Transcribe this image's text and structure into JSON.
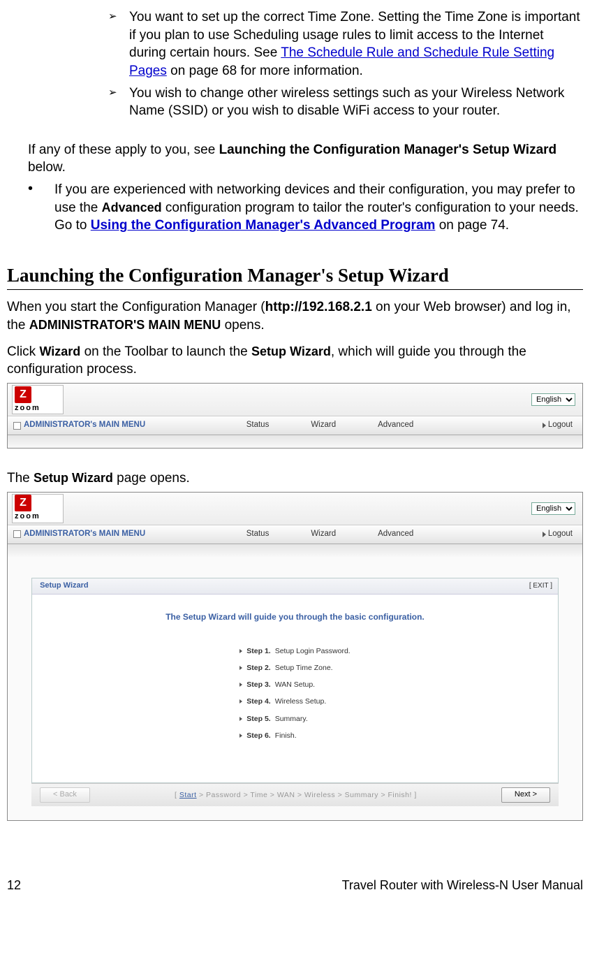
{
  "intro": {
    "bullet1_pre": "You want to set up the correct Time Zone. Setting the Time Zone is important if you plan to use Scheduling usage rules to limit access to the Internet during certain hours. See ",
    "bullet1_link": "The Schedule Rule and Schedule Rule Setting Pages",
    "bullet1_post": " on page 68 for more information.",
    "bullet2": "You wish to change other wireless settings such as your Wireless Network Name (SSID) or you wish to disable WiFi access to your router.",
    "apply_pre": "If any of these apply to you, see ",
    "apply_bold": "Launching the Configuration Manager's Setup Wizard",
    "apply_post": " below.",
    "dot_pre": "If you are experienced with networking devices and their configuration, you may prefer to use the ",
    "dot_adv": "Advanced",
    "dot_mid": " configuration program to tailor the router's configuration to your needs. Go to ",
    "dot_link": "Using the Configuration Manager's Advanced Program",
    "dot_post": " on page 74."
  },
  "heading": "Launching the Configuration Manager's Setup Wizard",
  "p1_pre": "When you start the Configuration Manager (",
  "p1_bold": "http://192.168.2.1",
  "p1_mid": " on your Web browser) and log in, the ",
  "p1_menu": "ADMINISTRATOR'S MAIN MENU",
  "p1_post": " opens.",
  "p2_pre": "Click ",
  "p2_w1": "Wizard",
  "p2_mid": " on the Toolbar to launch the ",
  "p2_w2": "Setup Wizard",
  "p2_post": ", which will guide you through the configuration process.",
  "p3_pre": "The ",
  "p3_sw": "Setup Wizard",
  "p3_post": " page opens.",
  "ui": {
    "logo_z": "Z",
    "logo_txt": "zoom",
    "lang": "English",
    "admin_menu": "ADMINISTRATOR's MAIN MENU",
    "status": "Status",
    "wizard": "Wizard",
    "advanced": "Advanced",
    "logout": "Logout",
    "panel_title": "Setup Wizard",
    "exit": "[ EXIT ]",
    "headline": "The Setup Wizard will guide you through the basic configuration.",
    "steps": [
      {
        "b": "Step 1.",
        "t": "Setup Login Password."
      },
      {
        "b": "Step 2.",
        "t": "Setup Time Zone."
      },
      {
        "b": "Step 3.",
        "t": "WAN Setup."
      },
      {
        "b": "Step 4.",
        "t": "Wireless Setup."
      },
      {
        "b": "Step 5.",
        "t": "Summary."
      },
      {
        "b": "Step 6.",
        "t": "Finish."
      }
    ],
    "back": "< Back",
    "next": "Next >",
    "bc_open": "[ ",
    "bc_start": "Start",
    "bc_rest": " > Password > Time > WAN > Wireless > Summary > Finish! ]"
  },
  "footer": {
    "page": "12",
    "title": "Travel Router with Wireless-N User Manual"
  }
}
